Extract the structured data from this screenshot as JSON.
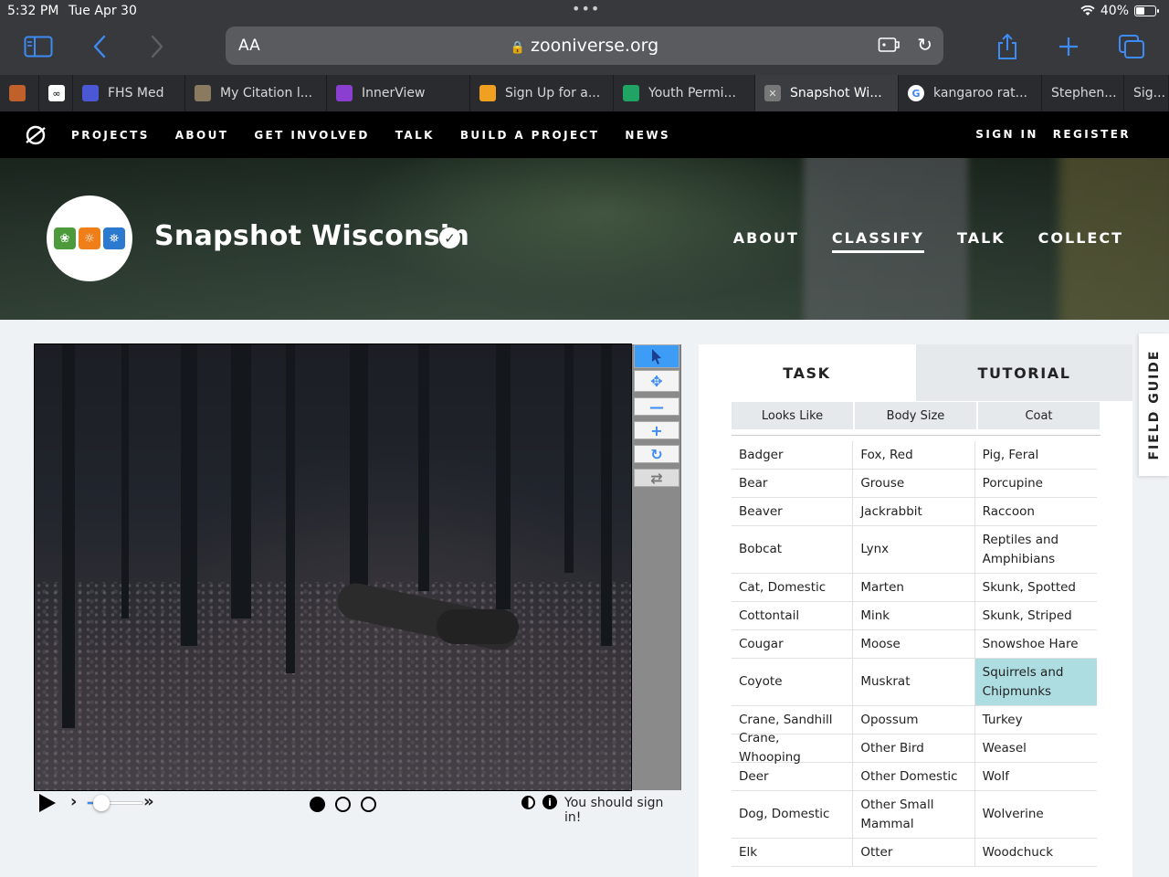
{
  "status": {
    "time": "5:32 PM",
    "date": "Tue Apr 30",
    "battery": "40%",
    "battery_level": 0.4
  },
  "browser": {
    "text_size_label": "AA",
    "url": "zooniverse.org",
    "tabs": [
      {
        "label": "",
        "icon": "tiger-favicon-icon",
        "color": "#c0602a"
      },
      {
        "label": "",
        "icon": "infinity-favicon-icon",
        "color": "#ffffff"
      },
      {
        "label": "FHS Med",
        "icon": "calendar-favicon-icon",
        "color": "#4a58d6"
      },
      {
        "label": "My Citation l...",
        "icon": "squirrel-favicon-icon",
        "color": "#8a7a60"
      },
      {
        "label": "InnerView",
        "icon": "innerview-favicon-icon",
        "color": "#8a3fd0"
      },
      {
        "label": "Sign Up for a...",
        "icon": "signup-favicon-icon",
        "color": "#f0a020"
      },
      {
        "label": "Youth Permi...",
        "icon": "google-drive-icon",
        "color": "#1fa463"
      },
      {
        "label": "Snapshot Wi...",
        "icon": "close-tab-icon",
        "color": "#777777"
      },
      {
        "label": "kangaroo rat...",
        "icon": "google-icon",
        "color": "#ffffff"
      },
      {
        "label": "Stephen...",
        "icon": "",
        "color": ""
      },
      {
        "label": "Sig...",
        "icon": "",
        "color": ""
      }
    ]
  },
  "site_nav": {
    "links": [
      "PROJECTS",
      "ABOUT",
      "GET INVOLVED",
      "TALK",
      "BUILD A PROJECT",
      "NEWS"
    ],
    "sign_in": "SIGN IN",
    "register": "REGISTER"
  },
  "project": {
    "title": "Snapshot Wisconsin",
    "nav": [
      "ABOUT",
      "CLASSIFY",
      "TALK",
      "COLLECT"
    ],
    "current_nav": "CLASSIFY"
  },
  "viewer": {
    "message": "You should sign in!",
    "frames": 3,
    "current_frame": 1,
    "speed_level": 0.25
  },
  "task_panel": {
    "tab_task": "TASK",
    "tab_tutorial": "TUTORIAL",
    "filters": [
      "Looks Like",
      "Body Size",
      "Coat"
    ],
    "rows": [
      [
        "Badger",
        "Fox, Red",
        "Pig, Feral"
      ],
      [
        "Bear",
        "Grouse",
        "Porcupine"
      ],
      [
        "Beaver",
        "Jackrabbit",
        "Raccoon"
      ],
      [
        "Bobcat",
        "Lynx",
        "Reptiles and Amphibians"
      ],
      [
        "Cat, Domestic",
        "Marten",
        "Skunk, Spotted"
      ],
      [
        "Cottontail",
        "Mink",
        "Skunk, Striped"
      ],
      [
        "Cougar",
        "Moose",
        "Snowshoe Hare"
      ],
      [
        "Coyote",
        "Muskrat",
        "Squirrels and Chipmunks"
      ],
      [
        "Crane, Sandhill",
        "Opossum",
        "Turkey"
      ],
      [
        "Crane, Whooping",
        "Other Bird",
        "Weasel"
      ],
      [
        "Deer",
        "Other Domestic",
        "Wolf"
      ],
      [
        "Dog, Domestic",
        "Other Small Mammal",
        "Wolverine"
      ],
      [
        "Elk",
        "Otter",
        "Woodchuck"
      ]
    ],
    "selected": "Squirrels and Chipmunks"
  },
  "field_guide": "FIELD GUIDE"
}
